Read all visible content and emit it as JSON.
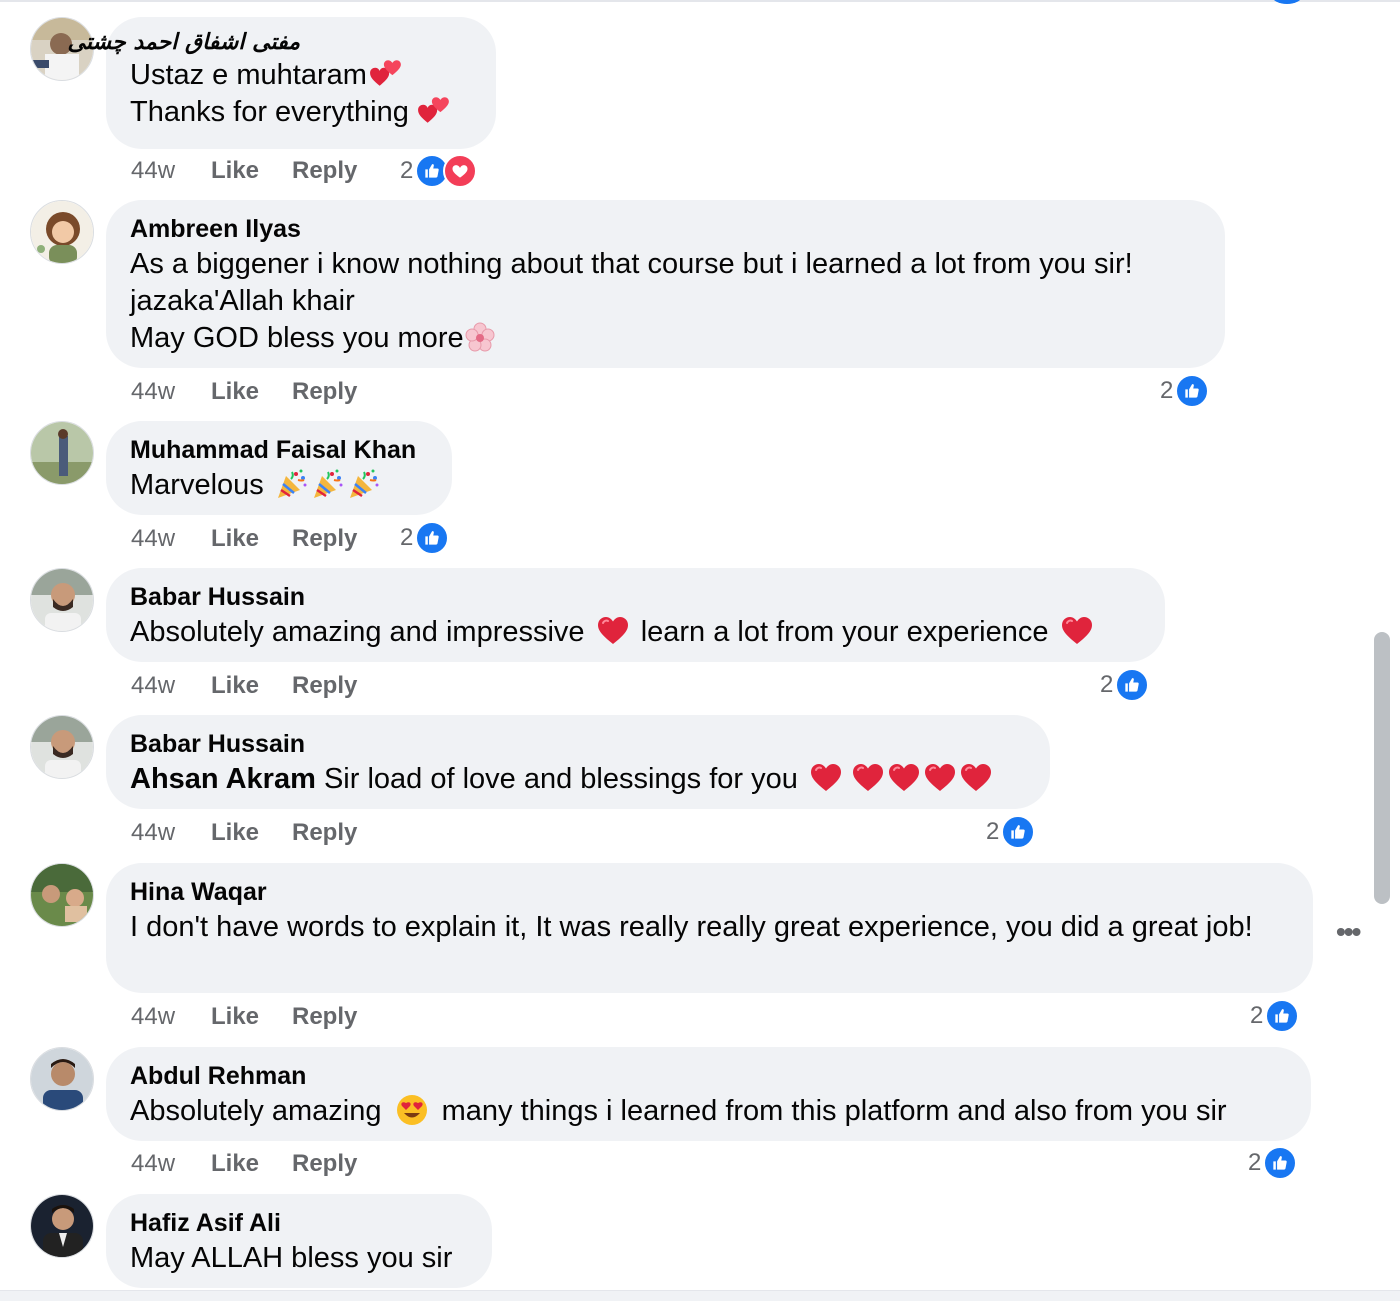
{
  "comments": [
    {
      "author": "مفتی اشفاق احمد چشتی",
      "lines": [
        "Ustaz e muhtaram",
        "Thanks for everything"
      ],
      "time": "44w",
      "like_label": "Like",
      "reply_label": "Reply",
      "reaction_count": "2",
      "reactions": [
        "like-icon",
        "love-icon"
      ]
    },
    {
      "author": "Ambreen Ilyas",
      "lines": [
        "As a biggener i know nothing about that course but i learned a lot from you sir!",
        "jazaka'Allah khair",
        "May GOD bless you more"
      ],
      "time": "44w",
      "like_label": "Like",
      "reply_label": "Reply",
      "reaction_count": "2",
      "reactions": [
        "like-icon"
      ]
    },
    {
      "author": "Muhammad Faisal Khan",
      "lines": [
        "Marvelous"
      ],
      "time": "44w",
      "like_label": "Like",
      "reply_label": "Reply",
      "reaction_count": "2",
      "reactions": [
        "like-icon"
      ]
    },
    {
      "author": "Babar Hussain",
      "lines": [
        "Absolutely amazing and impressive",
        "learn a lot from your experience"
      ],
      "time": "44w",
      "like_label": "Like",
      "reply_label": "Reply",
      "reaction_count": "2",
      "reactions": [
        "like-icon"
      ]
    },
    {
      "author": "Babar Hussain",
      "mention": "Ahsan Akram",
      "lines": [
        "Sir load of love and blessings for you"
      ],
      "time": "44w",
      "like_label": "Like",
      "reply_label": "Reply",
      "reaction_count": "2",
      "reactions": [
        "like-icon"
      ]
    },
    {
      "author": "Hina Waqar",
      "lines": [
        "I don't have words to explain it, It was really really great experience, you did a great job!"
      ],
      "time": "44w",
      "like_label": "Like",
      "reply_label": "Reply",
      "reaction_count": "2",
      "reactions": [
        "like-icon"
      ]
    },
    {
      "author": "Abdul Rehman",
      "lines": [
        "Absolutely amazing",
        "many things i learned from this platform and also from you sir"
      ],
      "time": "44w",
      "like_label": "Like",
      "reply_label": "Reply",
      "reaction_count": "2",
      "reactions": [
        "like-icon"
      ]
    },
    {
      "author": "Hafiz Asif Ali",
      "lines": [
        "May ALLAH bless you sir"
      ]
    }
  ],
  "more_options_icon": "more-horizontal-icon",
  "colors": {
    "bubble": "#f0f2f5",
    "like_blue": "#1877f2",
    "love_red": "#f33e58",
    "meta_gray": "#65676b",
    "heart_red": "#e0245e"
  }
}
